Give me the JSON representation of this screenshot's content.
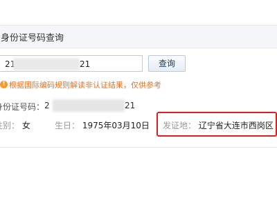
{
  "panel": {
    "title": "身份证号码查询"
  },
  "search": {
    "input_prefix": "21",
    "input_suffix": "21",
    "query_button": "查询"
  },
  "notice": {
    "icon": "warning-icon",
    "text": "根据国际编码规则解读非认证结果，仅供参考"
  },
  "result": {
    "id_label": "身份证号码：",
    "id_prefix": "2",
    "id_suffix": "21",
    "gender_label": "性别：",
    "gender_value": "女",
    "birthday_label": "生日：",
    "birthday_value": "1975年03月10日",
    "issuer_label": "发证地：",
    "issuer_value": "辽宁省大连市西岗区"
  },
  "colors": {
    "notice_text": "#e0762a",
    "highlight_border": "#e31d1d",
    "button_text": "#223a59"
  }
}
